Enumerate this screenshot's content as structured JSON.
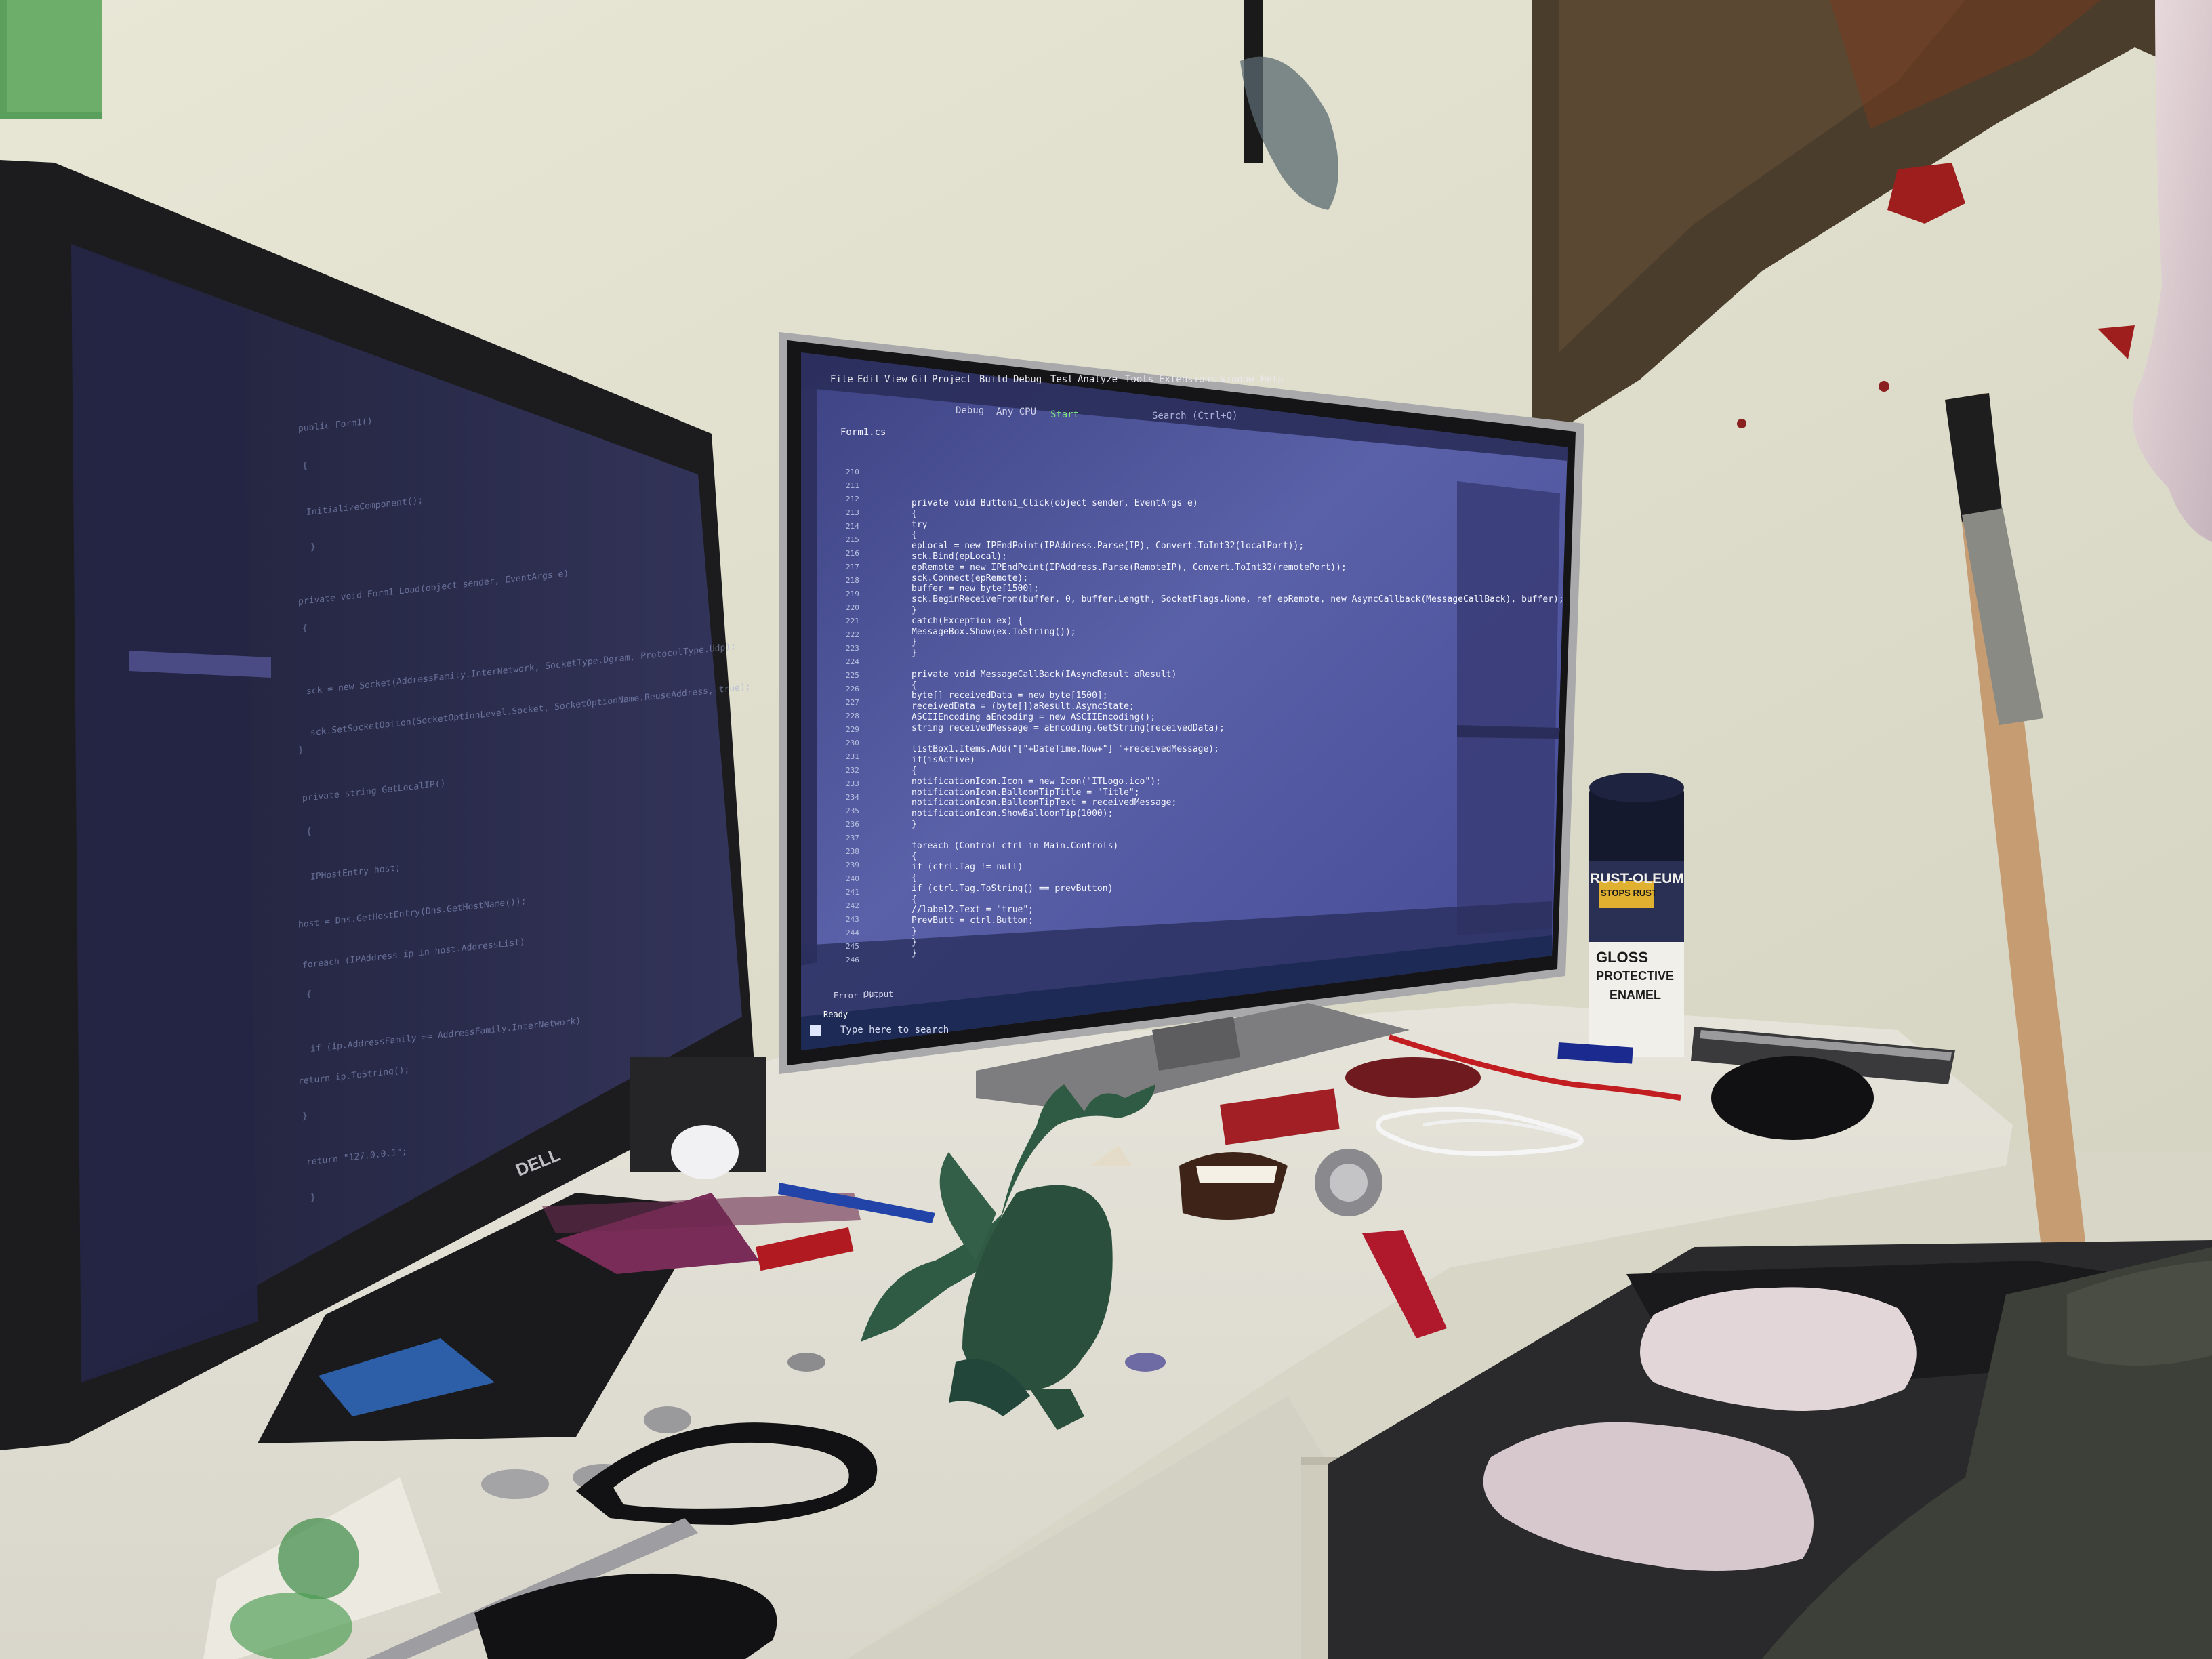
{
  "colors": {
    "wall": "#e4e2d2",
    "desk": "#e9e7de",
    "code_bg": "#4a4f8e",
    "code_text": "#f2f4ff",
    "left_screen": "#2a2b4a",
    "monitor_bezel": "#1f1f22",
    "dragon": "#2f5a44",
    "paint_can": "#15192e",
    "taskbar": "#1d2a55"
  },
  "right_monitor": {
    "menu": [
      "File",
      "Edit",
      "View",
      "Git",
      "Project",
      "Build",
      "Debug",
      "Test",
      "Analyze",
      "Tools",
      "Extensions",
      "Window",
      "Help"
    ],
    "toolbar": {
      "config": "Debug",
      "platform": "Any CPU",
      "start": "Start",
      "search_placeholder": "Search (Ctrl+Q)"
    },
    "tab": "Form1.cs",
    "code_lines": [
      "private void Button1_Click(object sender, EventArgs e)",
      "{",
      "    try",
      "    {",
      "        epLocal = new IPEndPoint(IPAddress.Parse(IP), Convert.ToInt32(localPort));",
      "        sck.Bind(epLocal);",
      "        epRemote = new IPEndPoint(IPAddress.Parse(RemoteIP), Convert.ToInt32(remotePort));",
      "        sck.Connect(epRemote);",
      "        buffer = new byte[1500];",
      "        sck.BeginReceiveFrom(buffer, 0, buffer.Length, SocketFlags.None, ref epRemote, new AsyncCallback(MessageCallBack), buffer);",
      "    }",
      "    catch(Exception ex) {",
      "        MessageBox.Show(ex.ToString());",
      "    }",
      "}",
      "",
      "private void MessageCallBack(IAsyncResult aResult)",
      "{",
      "    byte[] receivedData = new byte[1500];",
      "    receivedData = (byte[])aResult.AsyncState;",
      "    ASCIIEncoding aEncoding = new ASCIIEncoding();",
      "    string receivedMessage = aEncoding.GetString(receivedData);",
      "",
      "    listBox1.Items.Add(\"[\"+DateTime.Now+\"] \"+receivedMessage);",
      "    if(isActive)",
      "    {",
      "        notificationIcon.Icon = new Icon(\"ITLogo.ico\");",
      "        notificationIcon.BalloonTipTitle = \"Title\";",
      "        notificationIcon.BalloonTipText = receivedMessage;",
      "        notificationIcon.ShowBalloonTip(1000);",
      "    }",
      "",
      "    foreach (Control ctrl in Main.Controls)",
      "    {",
      "        if (ctrl.Tag != null)",
      "        {",
      "            if (ctrl.Tag.ToString() == prevButton)",
      "            {",
      "                //label2.Text = \"true\";",
      "                PrevButt = ctrl.Button;",
      "            }",
      "        }",
      "    }"
    ],
    "line_numbers": [
      "210",
      "211",
      "212",
      "213",
      "214",
      "215",
      "216",
      "217",
      "218",
      "219",
      "220",
      "221",
      "222",
      "223",
      "224",
      "225",
      "226",
      "227",
      "228",
      "229",
      "230",
      "231",
      "232",
      "233",
      "234",
      "235",
      "236",
      "237",
      "238",
      "239",
      "240",
      "241",
      "242",
      "243",
      "244",
      "245",
      "246"
    ],
    "bottom_tab": "Error List",
    "output_tab": "Output",
    "status": "Ready",
    "taskbar_search": "Type here to search"
  },
  "left_monitor": {
    "brand": "DELL",
    "code_lines": [
      "public Form1()",
      "{",
      "    InitializeComponent();",
      "}",
      "private void Form1_Load(object sender, EventArgs e)",
      "{",
      "    sck = new Socket(AddressFamily.InterNetwork, SocketType.Dgram, ProtocolType.Udp);",
      "    sck.SetSocketOption(SocketOptionLevel.Socket, SocketOptionName.ReuseAddress, true);",
      "}",
      "private string GetLocalIP()",
      "{",
      "    IPHostEntry host;",
      "    host = Dns.GetHostEntry(Dns.GetHostName());",
      "    foreach (IPAddress ip in host.AddressList)",
      "    {",
      "        if (ip.AddressFamily == AddressFamily.InterNetwork)",
      "            return ip.ToString();",
      "    }",
      "    return \"127.0.0.1\";",
      "}"
    ]
  },
  "paint_can": {
    "brand": "RUST-OLEUM",
    "badge": "STOPS RUST",
    "line1": "GLOSS",
    "line2": "PROTECTIVE",
    "line3": "ENAMEL"
  }
}
